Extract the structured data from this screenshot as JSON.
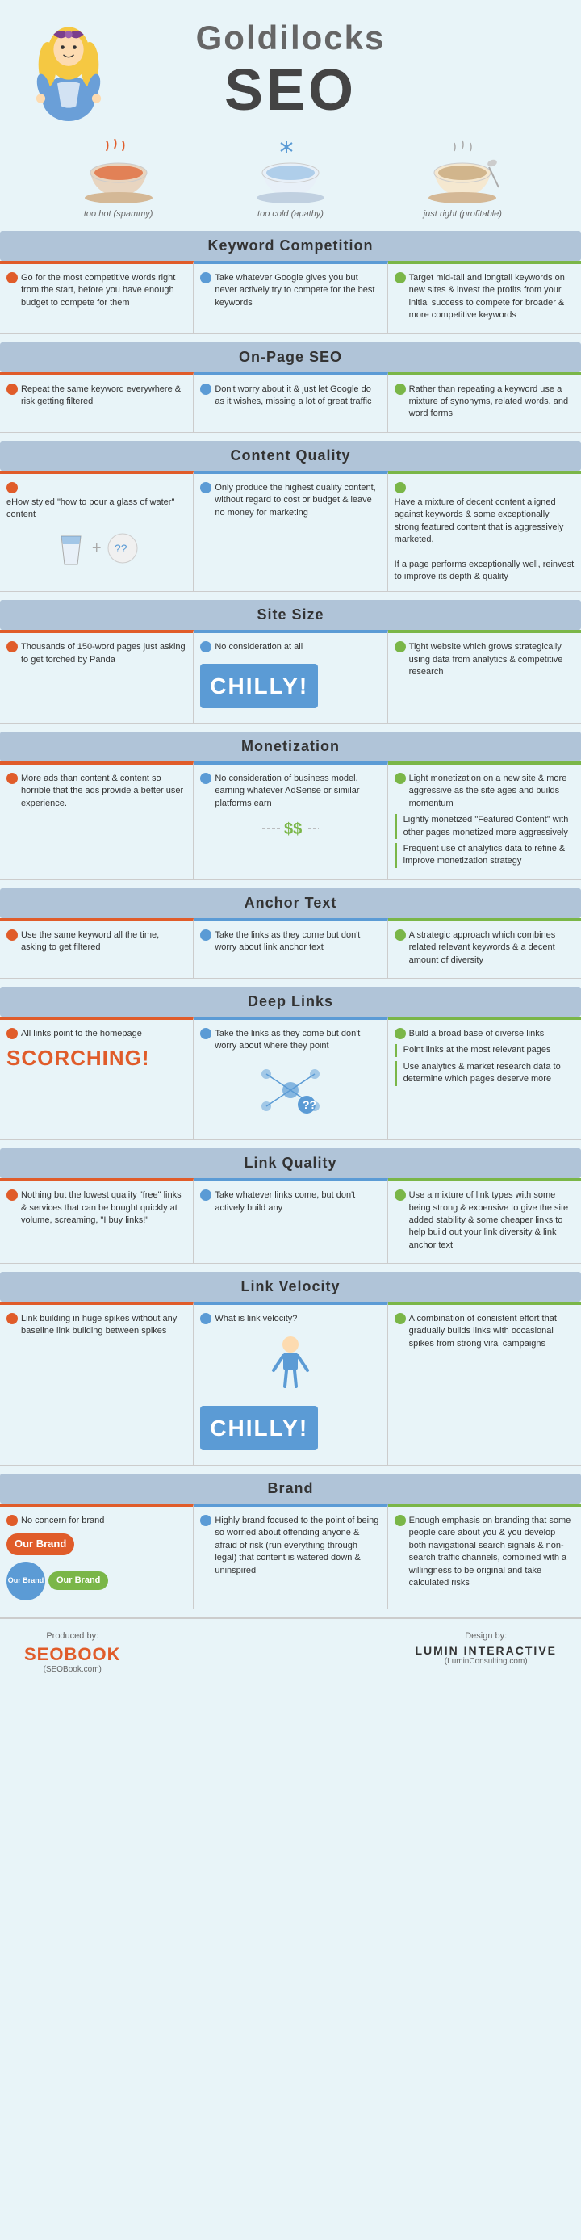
{
  "header": {
    "title_line1": "Goldilocks",
    "title_line2": "SEO"
  },
  "bowls": [
    {
      "label": "too hot (spammy)"
    },
    {
      "label": "too cold (apathy)"
    },
    {
      "label": "just right (profitable)"
    }
  ],
  "sections": [
    {
      "title": "Keyword Competition",
      "cols": [
        {
          "type": "hot",
          "text": "Go for the most competitive words right from the start, before you have enough budget to compete for them"
        },
        {
          "type": "cold",
          "text": "Take whatever Google gives you but never actively try to compete for the best keywords"
        },
        {
          "type": "right",
          "text": "Target mid-tail and longtail keywords on new sites & invest the profits from your initial success to compete for broader & more competitive keywords"
        }
      ]
    },
    {
      "title": "On-Page SEO",
      "cols": [
        {
          "type": "hot",
          "text": "Repeat the same keyword everywhere & risk getting filtered"
        },
        {
          "type": "cold",
          "text": "Don't worry about it & just let Google do as it wishes, missing a lot of great traffic"
        },
        {
          "type": "right",
          "text": "Rather than repeating a keyword use a mixture of synonyms, related words, and word forms"
        }
      ]
    },
    {
      "title": "Content Quality",
      "cols": [
        {
          "type": "hot",
          "text": "eHow styled \"how to pour a glass of water\" content"
        },
        {
          "type": "cold",
          "text": "Only produce the highest quality content, without regard to cost or budget & leave no money for marketing"
        },
        {
          "type": "right",
          "text": "Have a mixture of decent content aligned against keywords & some exceptionally strong featured content that is aggressively marketed.\n\nIf a page performs exceptionally well, reinvest to improve its depth & quality"
        }
      ]
    },
    {
      "title": "Site Size",
      "cols": [
        {
          "type": "hot",
          "text": "Thousands of 150-word pages just asking to get torched by Panda"
        },
        {
          "type": "cold",
          "text": "No consideration at all",
          "special": "chilly"
        },
        {
          "type": "right",
          "text": "Tight website which grows strategically using data from analytics & competitive research"
        }
      ]
    },
    {
      "title": "Monetization",
      "cols": [
        {
          "type": "hot",
          "text": "More ads than content & content so horrible that the ads provide a better user experience."
        },
        {
          "type": "cold",
          "text": "No consideration of business model, earning whatever AdSense or similar platforms earn"
        },
        {
          "type": "right",
          "text": "Light monetization on a new site & more aggressive as the site ages and builds momentum",
          "sub1": "Lightly monetized \"Featured Content\" with other pages monetized more aggressively",
          "sub2": "Frequent use of analytics data to refine & improve monetization strategy"
        }
      ]
    },
    {
      "title": "Anchor Text",
      "cols": [
        {
          "type": "hot",
          "text": "Use the same keyword all the time, asking to get filtered"
        },
        {
          "type": "cold",
          "text": "Take the links as they come but don't worry about link anchor text"
        },
        {
          "type": "right",
          "text": "A strategic approach which combines related relevant keywords & a decent amount of diversity"
        }
      ]
    },
    {
      "title": "Deep Links",
      "cols": [
        {
          "type": "hot",
          "text": "All links point to the homepage",
          "special": "scorching"
        },
        {
          "type": "cold",
          "text": "Take the links as they come but don't worry about where they point",
          "special": "question"
        },
        {
          "type": "right",
          "text": "Build a broad base of diverse links",
          "sub1": "Point links at the most relevant pages",
          "sub2": "Use analytics & market research data to determine which pages deserve more"
        }
      ]
    },
    {
      "title": "Link Quality",
      "cols": [
        {
          "type": "hot",
          "text": "Nothing but the lowest quality \"free\" links & services that can be bought quickly at volume, screaming, \"I buy links!\""
        },
        {
          "type": "cold",
          "text": "Take whatever links come, but don't actively build any"
        },
        {
          "type": "right",
          "text": "Use a mixture of link types with some being strong & expensive to give the site added stability & some cheaper links to help build out your link diversity & link anchor text"
        }
      ]
    },
    {
      "title": "Link Velocity",
      "cols": [
        {
          "type": "hot",
          "text": "Link building in huge spikes without any baseline link building between spikes"
        },
        {
          "type": "cold",
          "text": "What is link velocity?",
          "special": "chilly2"
        },
        {
          "type": "right",
          "text": "A combination of consistent effort that gradually builds links with occasional spikes from strong viral campaigns"
        }
      ]
    },
    {
      "title": "Brand",
      "cols": [
        {
          "type": "hot",
          "text": "No concern for brand",
          "special": "brand"
        },
        {
          "type": "cold",
          "text": "Highly brand focused to the point of being so worried about offending anyone & afraid of risk (run everything through legal) that content is watered down & uninspired"
        },
        {
          "type": "right",
          "text": "Enough emphasis on branding that some people care about you & you develop both navigational search signals & non-search traffic channels, combined with a willingness to be original and take calculated risks"
        }
      ]
    }
  ],
  "footer": {
    "produced_by": "Produced by:",
    "seobook": "SEOBOOK",
    "seobook_url": "(SEOBook.com)",
    "design_by": "Design by:",
    "lumin": "LUMIN INTERACTIVE",
    "lumin_url": "(LuminConsulting.com)"
  },
  "chilly_text": "CHILLY!",
  "scorching_text": "SCORCHING!",
  "dollar_text": "$$"
}
